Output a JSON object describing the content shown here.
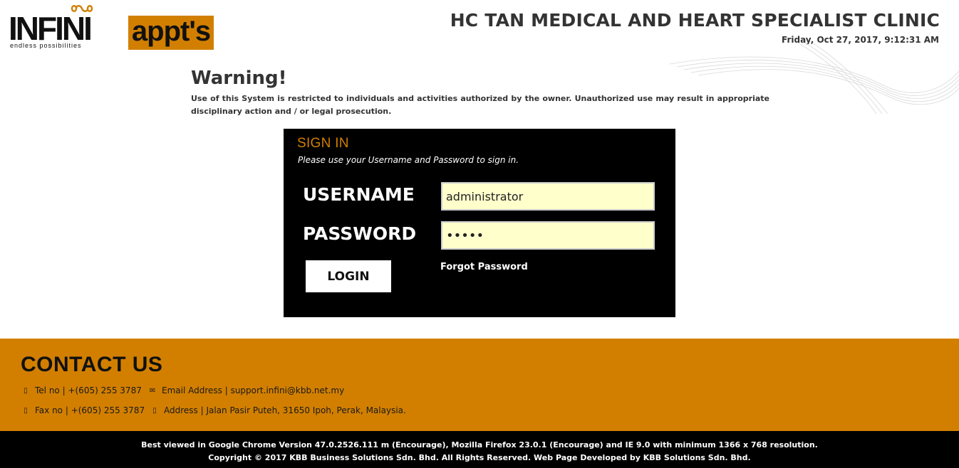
{
  "header": {
    "logo_text": "INFINI",
    "logo_tagline": "endless possibilities",
    "logo_appts": "appt's",
    "clinic_name": "HC TAN MEDICAL AND HEART SPECIALIST CLINIC",
    "datetime": "Friday, Oct 27, 2017, 9:12:31 AM"
  },
  "warning": {
    "title": "Warning!",
    "message": "Use of this System is restricted to individuals and activities authorized by the owner. Unauthorized use may result in appropriate disciplinary action and / or legal prosecution."
  },
  "signin": {
    "title": "SIGN IN",
    "subtitle": "Please use your Username and Password to sign in.",
    "username_label": "USERNAME",
    "username_value": "administrator",
    "password_label": "PASSWORD",
    "password_value": "•••••",
    "login_label": "LOGIN",
    "forgot_label": "Forgot Password"
  },
  "contact": {
    "title": "CONTACT US",
    "tel": "Tel no | +(605) 255 3787",
    "email": "Email Address | support.infini@kbb.net.my",
    "fax": "Fax no | +(605) 255 3787",
    "address": "Address | Jalan Pasir Puteh, 31650 Ipoh, Perak, Malaysia."
  },
  "footer": {
    "line1": "Best viewed in Google Chrome Version 47.0.2526.111 m (Encourage), Mozilla Firefox 23.0.1 (Encourage) and IE 9.0 with minimum 1366 x 768 resolution.",
    "line2": "Copyright © 2017 KBB Business Solutions Sdn. Bhd. All Rights Reserved. Web Page Developed by KBB Solutions Sdn. Bhd."
  },
  "colors": {
    "accent": "#d27f00",
    "input_bg": "#ffffcc",
    "panel_bg": "#000000"
  },
  "icons": {
    "tel": "phone-icon",
    "email": "envelope-icon",
    "fax": "fax-icon",
    "address": "map-marker-icon"
  }
}
